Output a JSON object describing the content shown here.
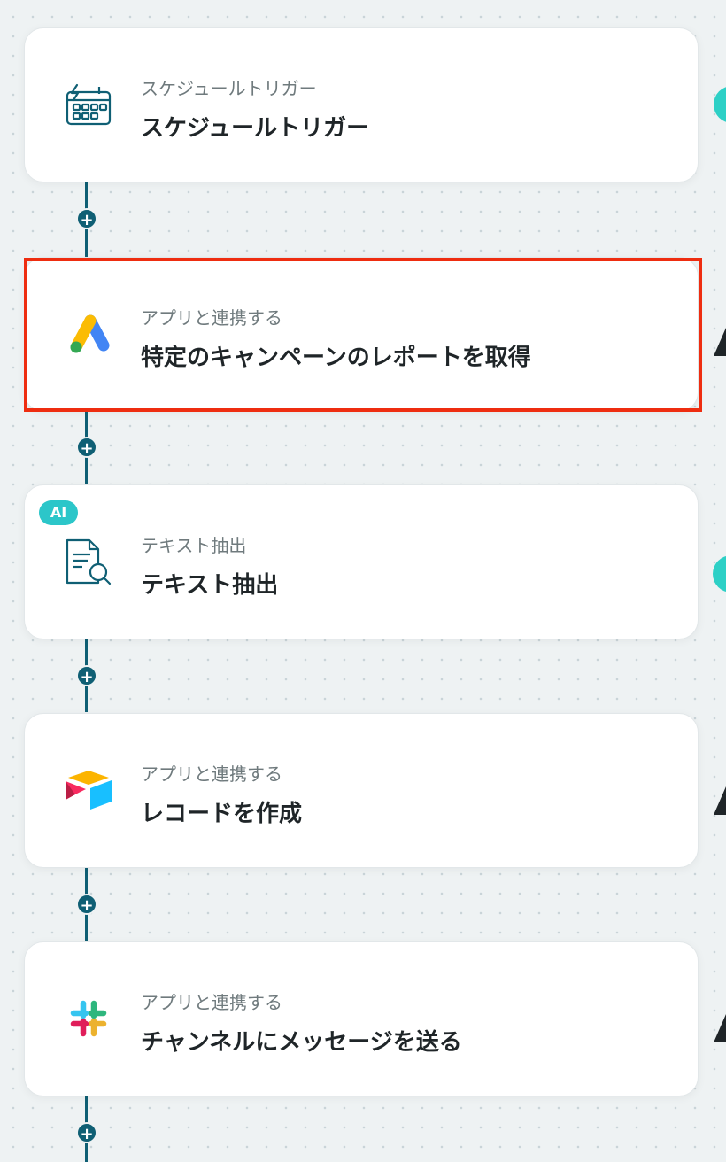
{
  "flow": {
    "steps": [
      {
        "subtitle": "スケジュールトリガー",
        "title": "スケジュールトリガー",
        "icon": "schedule-calendar-icon"
      },
      {
        "subtitle": "アプリと連携する",
        "title": "特定のキャンペーンのレポートを取得",
        "icon": "google-ads-icon"
      },
      {
        "subtitle": "テキスト抽出",
        "title": "テキスト抽出",
        "icon": "document-search-icon",
        "badge": "AI"
      },
      {
        "subtitle": "アプリと連携する",
        "title": "レコードを作成",
        "icon": "airtable-icon"
      },
      {
        "subtitle": "アプリと連携する",
        "title": "チャンネルにメッセージを送る",
        "icon": "slack-icon"
      }
    ],
    "add_step_symbol": "+"
  },
  "colors": {
    "connector": "#0f5f74",
    "highlight": "#ee2d10",
    "ai_badge": "#2cc6c9",
    "teal_indicator": "#2dd0c6"
  }
}
